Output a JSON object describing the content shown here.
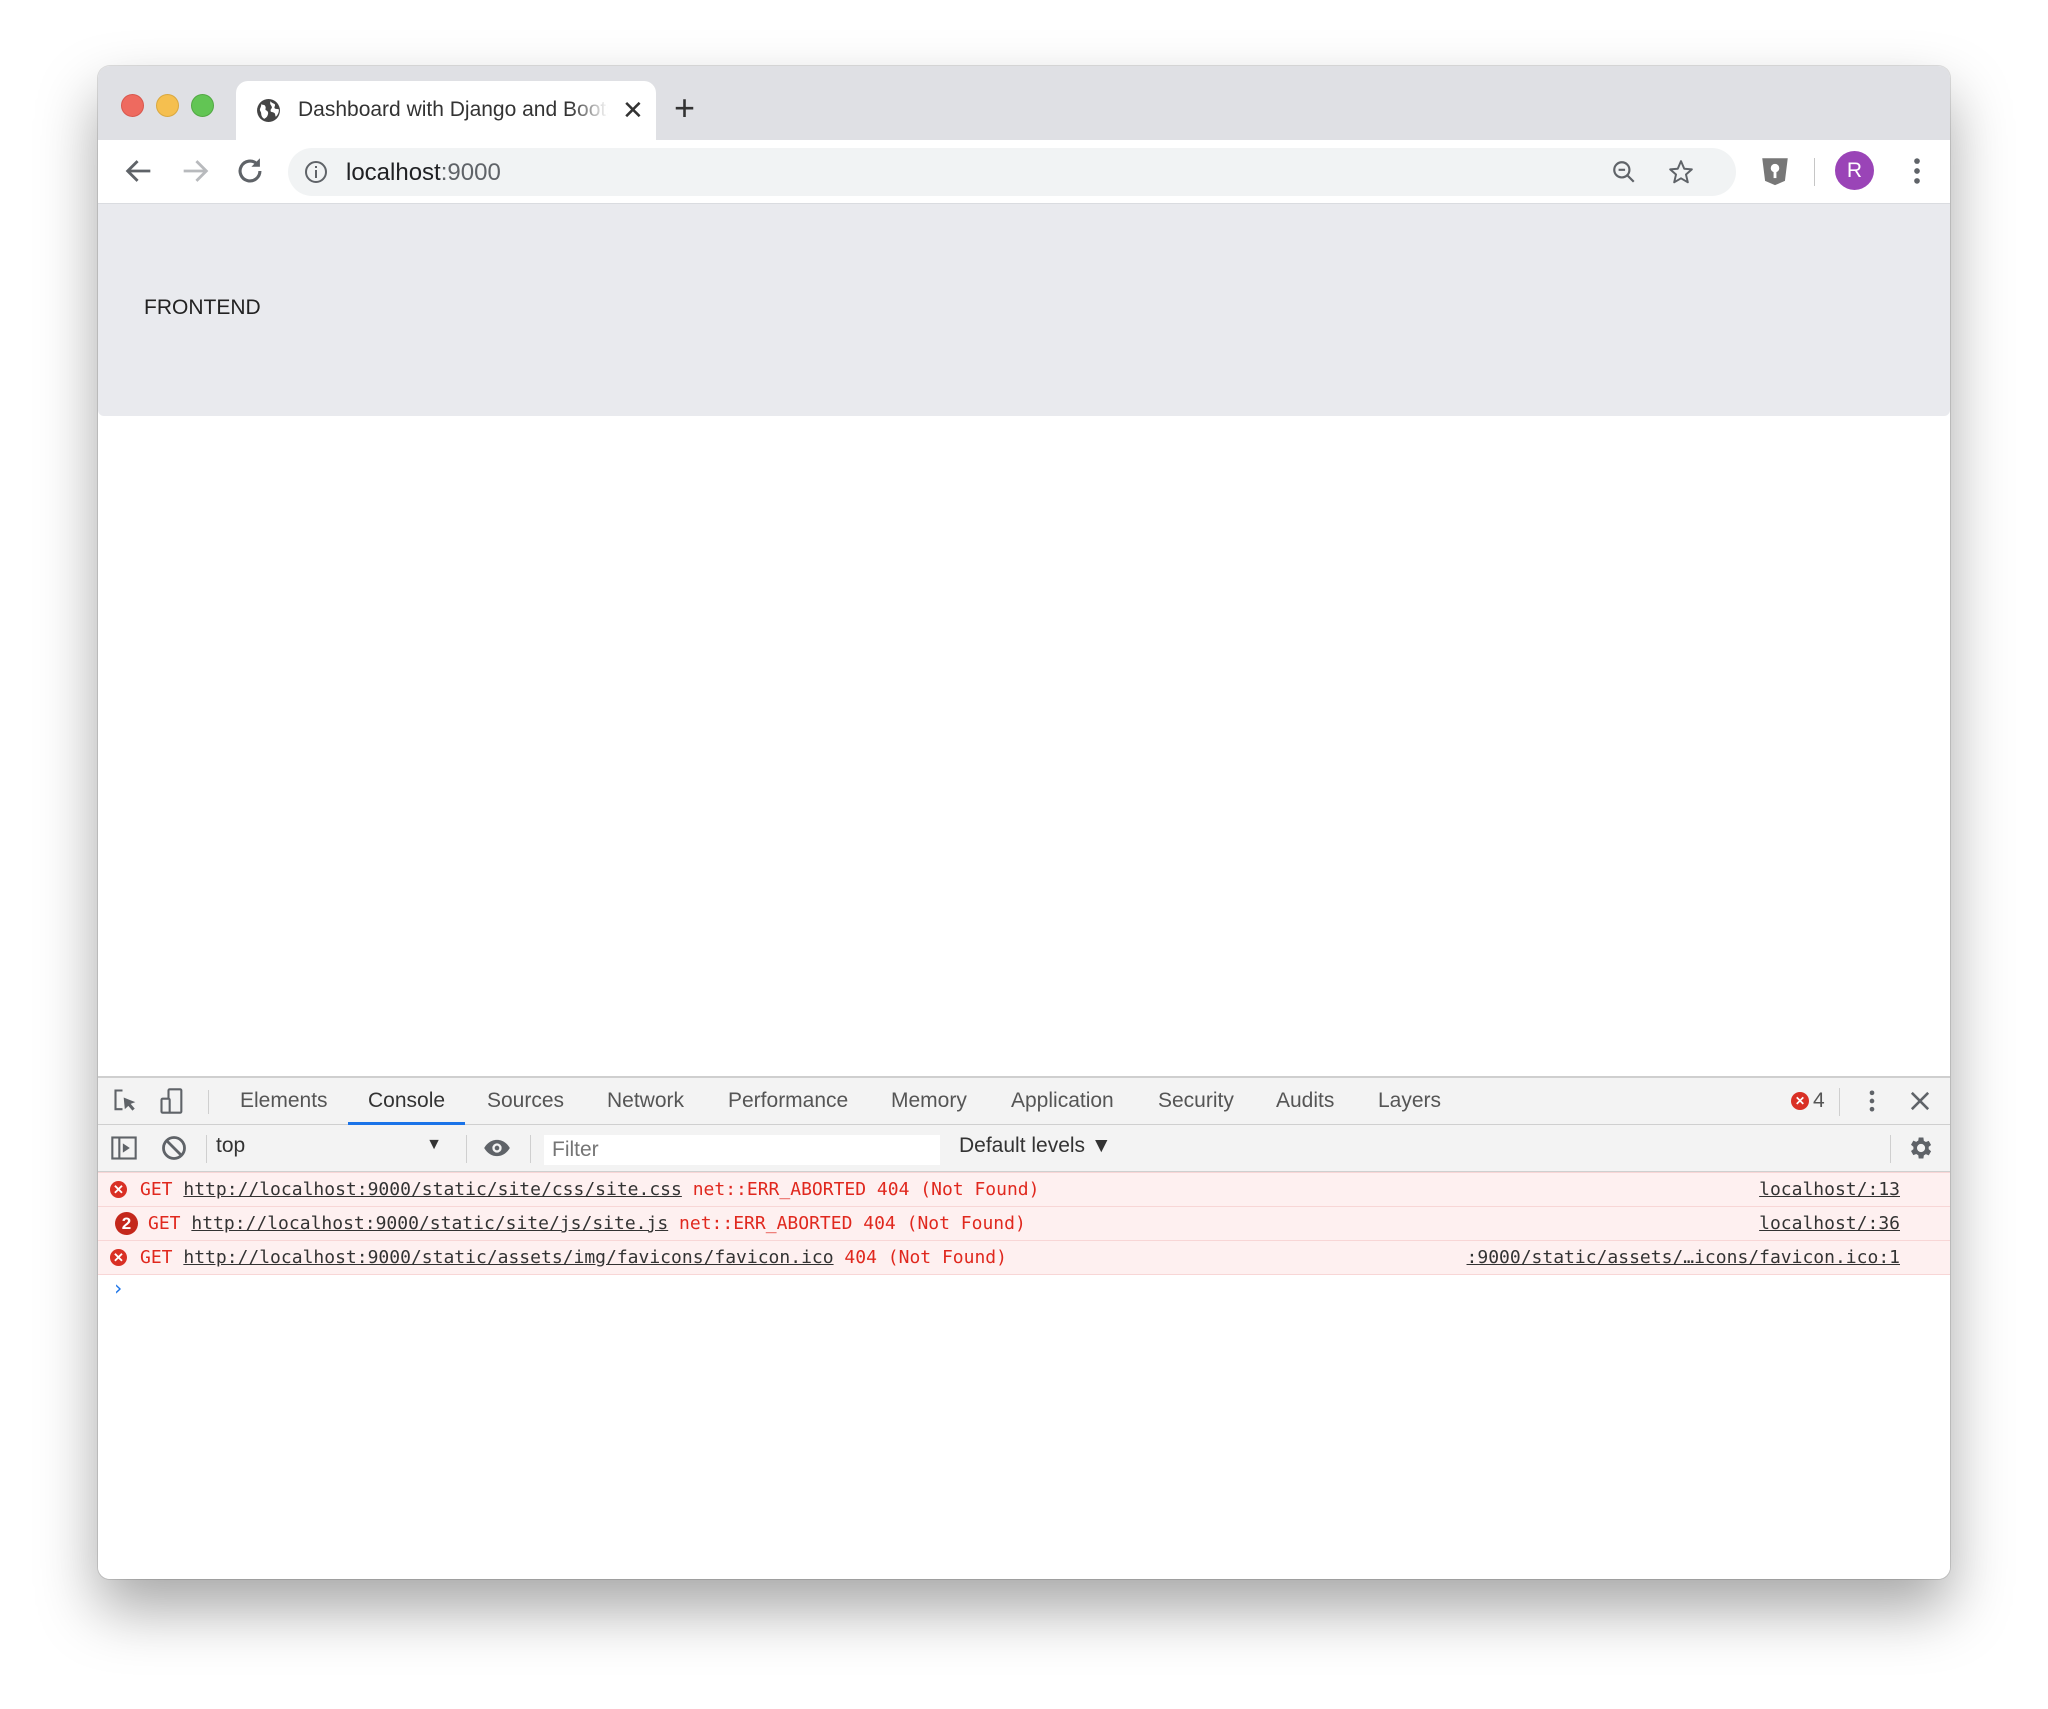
{
  "browser": {
    "tab": {
      "title": "Dashboard with Django and Bootstrap",
      "close": "✕"
    },
    "new_tab": "+",
    "address": {
      "host": "localhost",
      "port": ":9000"
    },
    "profile_initial": "R",
    "colors": {
      "avatar": "#9a44b7",
      "tab_strip": "#dfe0e4"
    }
  },
  "page": {
    "hero_text": "FRONTEND"
  },
  "devtools": {
    "tabs": [
      {
        "label": "Elements"
      },
      {
        "label": "Console",
        "active": true
      },
      {
        "label": "Sources"
      },
      {
        "label": "Network"
      },
      {
        "label": "Performance"
      },
      {
        "label": "Memory"
      },
      {
        "label": "Application"
      },
      {
        "label": "Security"
      },
      {
        "label": "Audits"
      },
      {
        "label": "Layers"
      }
    ],
    "error_count": "4",
    "context": "top",
    "filter_placeholder": "Filter",
    "levels": "Default levels ▼",
    "messages": [
      {
        "repeat": null,
        "method": "GET",
        "url": "http://localhost:9000/static/site/css/site.css",
        "detail": "net::ERR_ABORTED 404 (Not Found)",
        "source": "localhost/:13"
      },
      {
        "repeat": "2",
        "method": "GET",
        "url": "http://localhost:9000/static/site/js/site.js",
        "detail": "net::ERR_ABORTED 404 (Not Found)",
        "source": "localhost/:36"
      },
      {
        "repeat": null,
        "method": "GET",
        "url": "http://localhost:9000/static/assets/img/favicons/favicon.ico",
        "detail": "404 (Not Found)",
        "source": ":9000/static/assets/…icons/favicon.ico:1"
      }
    ],
    "prompt": "›"
  }
}
